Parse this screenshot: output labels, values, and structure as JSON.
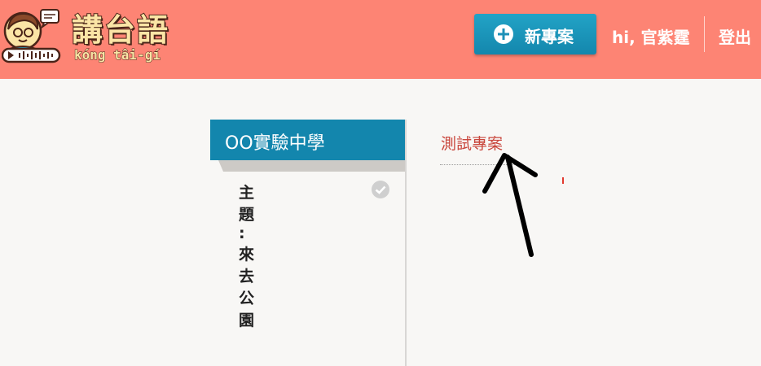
{
  "header": {
    "logo_title": "講台語",
    "logo_subtitle": "kóng tâi-gí",
    "new_project_label": "新專案",
    "greeting": "hi, 官紫霆",
    "logout_label": "登出",
    "colors": {
      "header_bg": "#fd8474",
      "button_bg": "#1c97bf"
    }
  },
  "sidebar": {
    "school_name": "OO實驗中學",
    "topic": "主題 : 來去公園"
  },
  "main": {
    "project_name": "測試專案"
  }
}
